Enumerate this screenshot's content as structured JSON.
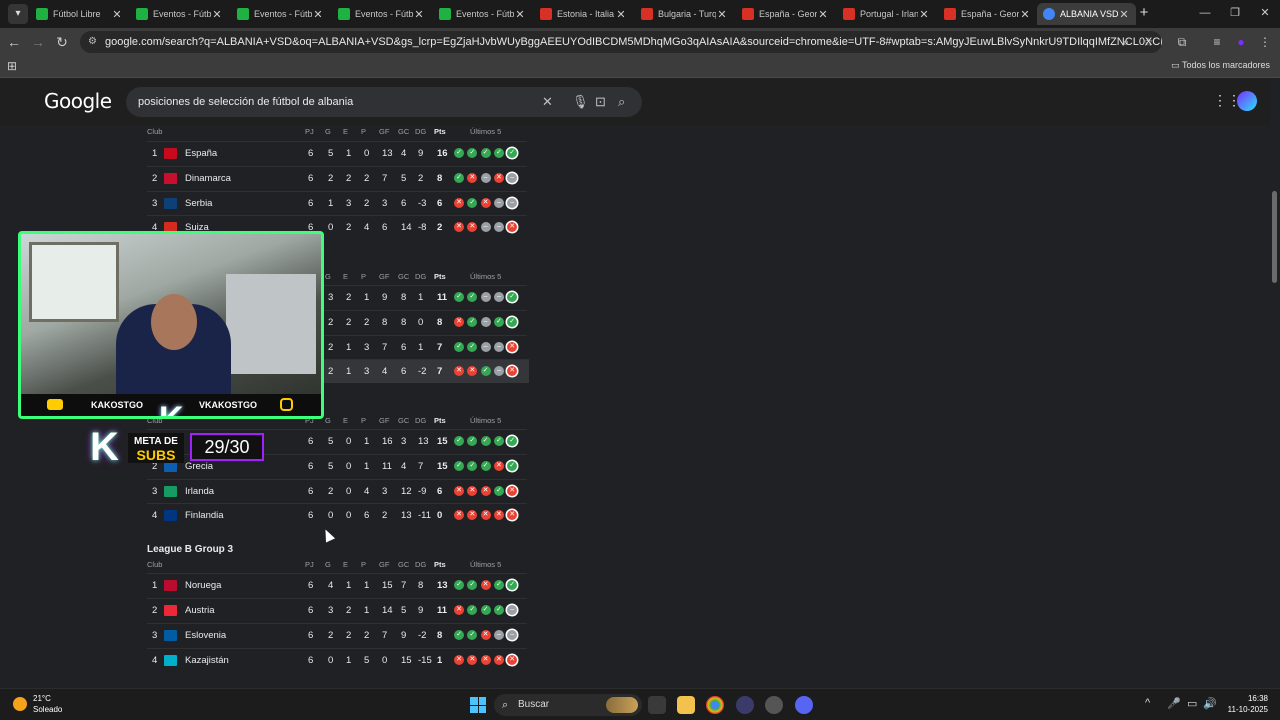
{
  "browser": {
    "tabs": [
      {
        "title": "Fútbol Libre",
        "favicon": "green",
        "icon": "tv-icon"
      },
      {
        "title": "Eventos - Fútbol",
        "favicon": "green"
      },
      {
        "title": "Eventos - Fútbol",
        "favicon": "green"
      },
      {
        "title": "Eventos - Fútbol",
        "favicon": "green"
      },
      {
        "title": "Eventos - Fútbol",
        "favicon": "green"
      },
      {
        "title": "Estonia - Italia",
        "favicon": "red"
      },
      {
        "title": "Bulgaria - Turquía",
        "favicon": "red"
      },
      {
        "title": "España - Georgia",
        "favicon": "red"
      },
      {
        "title": "Portugal - Irlanda",
        "favicon": "red"
      },
      {
        "title": "España - Georgia",
        "favicon": "red"
      },
      {
        "title": "ALBANIA VSD",
        "favicon": "goog",
        "active": true
      }
    ],
    "url": "google.com/search?q=ALBANIA+VSD&oq=ALBANIA+VSD&gs_lcrp=EgZjaHJvbWUyBggAEEUYOdIBCDM5MDhqMGo3qAIAsAIA&sourceid=chrome&ie=UTF-8#wptab=s:AMgyJEuwLBlvSyNnkrU9TDIlqqIMfZNCL0XCB2_RK4K6F4QhK4G-0HZGjqm...",
    "bookmarks_all": "Todos los marcadores"
  },
  "google": {
    "logo": "Google",
    "query": "posiciones de selección de fútbol de albania"
  },
  "table_headers": {
    "club": "Club",
    "pj": "PJ",
    "g": "G",
    "e": "E",
    "p": "P",
    "gf": "GF",
    "gc": "GC",
    "dg": "DG",
    "pts": "Pts",
    "last5": "Últimos 5"
  },
  "groups": [
    {
      "title": "",
      "rows": [
        {
          "pos": "1",
          "team": "España",
          "pj": "6",
          "g": "5",
          "e": "1",
          "p": "0",
          "gf": "13",
          "gc": "4",
          "dg": "9",
          "pts": "16",
          "form": [
            "W",
            "W",
            "W",
            "W",
            "W"
          ],
          "flag": "#c60b1e"
        },
        {
          "pos": "2",
          "team": "Dinamarca",
          "pj": "6",
          "g": "2",
          "e": "2",
          "p": "2",
          "gf": "7",
          "gc": "5",
          "dg": "2",
          "pts": "8",
          "form": [
            "W",
            "L",
            "D",
            "L",
            "D"
          ],
          "flag": "#c8102e"
        },
        {
          "pos": "3",
          "team": "Serbia",
          "pj": "6",
          "g": "1",
          "e": "3",
          "p": "2",
          "gf": "3",
          "gc": "6",
          "dg": "-3",
          "pts": "6",
          "form": [
            "L",
            "W",
            "L",
            "D",
            "D"
          ],
          "flag": "#0c4076"
        },
        {
          "pos": "4",
          "team": "Suiza",
          "pj": "6",
          "g": "0",
          "e": "2",
          "p": "4",
          "gf": "6",
          "gc": "14",
          "dg": "-8",
          "pts": "2",
          "form": [
            "L",
            "L",
            "D",
            "D",
            "L"
          ],
          "flag": "#d52b1e"
        }
      ]
    },
    {
      "title": "",
      "rows": [
        {
          "pos": "",
          "team": "",
          "pj": "",
          "g": "3",
          "e": "2",
          "p": "1",
          "gf": "9",
          "gc": "8",
          "dg": "1",
          "pts": "11",
          "form": [
            "W",
            "W",
            "D",
            "D",
            "W"
          ],
          "flag": ""
        },
        {
          "pos": "",
          "team": "",
          "pj": "",
          "g": "2",
          "e": "2",
          "p": "2",
          "gf": "8",
          "gc": "8",
          "dg": "0",
          "pts": "8",
          "form": [
            "L",
            "W",
            "D",
            "W",
            "W"
          ],
          "flag": ""
        },
        {
          "pos": "",
          "team": "",
          "pj": "",
          "g": "2",
          "e": "1",
          "p": "3",
          "gf": "7",
          "gc": "6",
          "dg": "1",
          "pts": "7",
          "form": [
            "W",
            "W",
            "D",
            "D",
            "L"
          ],
          "flag": ""
        },
        {
          "pos": "",
          "team": "",
          "pj": "",
          "g": "2",
          "e": "1",
          "p": "3",
          "gf": "4",
          "gc": "6",
          "dg": "-2",
          "pts": "7",
          "form": [
            "L",
            "L",
            "W",
            "D",
            "L"
          ],
          "flag": "",
          "highlight": true
        }
      ]
    },
    {
      "title": "",
      "rows": [
        {
          "pos": "",
          "team": "",
          "pj": "6",
          "g": "5",
          "e": "0",
          "p": "1",
          "gf": "16",
          "gc": "3",
          "dg": "13",
          "pts": "15",
          "form": [
            "W",
            "W",
            "W",
            "W",
            "W"
          ],
          "flag": ""
        },
        {
          "pos": "2",
          "team": "Grecia",
          "pj": "6",
          "g": "5",
          "e": "0",
          "p": "1",
          "gf": "11",
          "gc": "4",
          "dg": "7",
          "pts": "15",
          "form": [
            "W",
            "W",
            "W",
            "L",
            "W"
          ],
          "flag": "#0d5eaf"
        },
        {
          "pos": "3",
          "team": "Irlanda",
          "pj": "6",
          "g": "2",
          "e": "0",
          "p": "4",
          "gf": "3",
          "gc": "12",
          "dg": "-9",
          "pts": "6",
          "form": [
            "L",
            "L",
            "L",
            "W",
            "L"
          ],
          "flag": "#169b62"
        },
        {
          "pos": "4",
          "team": "Finlandia",
          "pj": "6",
          "g": "0",
          "e": "0",
          "p": "6",
          "gf": "2",
          "gc": "13",
          "dg": "-11",
          "pts": "0",
          "form": [
            "L",
            "L",
            "L",
            "L",
            "L"
          ],
          "flag": "#003580"
        }
      ]
    },
    {
      "title": "League B Group 3",
      "rows": [
        {
          "pos": "1",
          "team": "Noruega",
          "pj": "6",
          "g": "4",
          "e": "1",
          "p": "1",
          "gf": "15",
          "gc": "7",
          "dg": "8",
          "pts": "13",
          "form": [
            "W",
            "W",
            "L",
            "W",
            "W"
          ],
          "flag": "#ba0c2f"
        },
        {
          "pos": "2",
          "team": "Austria",
          "pj": "6",
          "g": "3",
          "e": "2",
          "p": "1",
          "gf": "14",
          "gc": "5",
          "dg": "9",
          "pts": "11",
          "form": [
            "L",
            "W",
            "W",
            "W",
            "D"
          ],
          "flag": "#ed2939"
        },
        {
          "pos": "3",
          "team": "Eslovenia",
          "pj": "6",
          "g": "2",
          "e": "2",
          "p": "2",
          "gf": "7",
          "gc": "9",
          "dg": "-2",
          "pts": "8",
          "form": [
            "W",
            "W",
            "L",
            "D",
            "D"
          ],
          "flag": "#005da4"
        },
        {
          "pos": "4",
          "team": "Kazajistán",
          "pj": "6",
          "g": "0",
          "e": "1",
          "p": "5",
          "gf": "0",
          "gc": "15",
          "dg": "-15",
          "pts": "1",
          "form": [
            "L",
            "L",
            "L",
            "L",
            "L"
          ],
          "flag": "#00afca"
        }
      ]
    }
  ],
  "overlay": {
    "left_handle": "KAKOSTGO",
    "right_handle": "VKAKOSTGO",
    "meta_line1": "META DE",
    "meta_line2": "SUBS",
    "subs_count": "29/30"
  },
  "taskbar": {
    "temp": "21°C",
    "weather": "Soleado",
    "search": "Buscar",
    "time": "16:38",
    "date": "11-10-2025"
  },
  "colors": {
    "win": "#34a853",
    "loss": "#ea4335",
    "draw": "#9aa0a6",
    "accent": "#3cff7a"
  }
}
